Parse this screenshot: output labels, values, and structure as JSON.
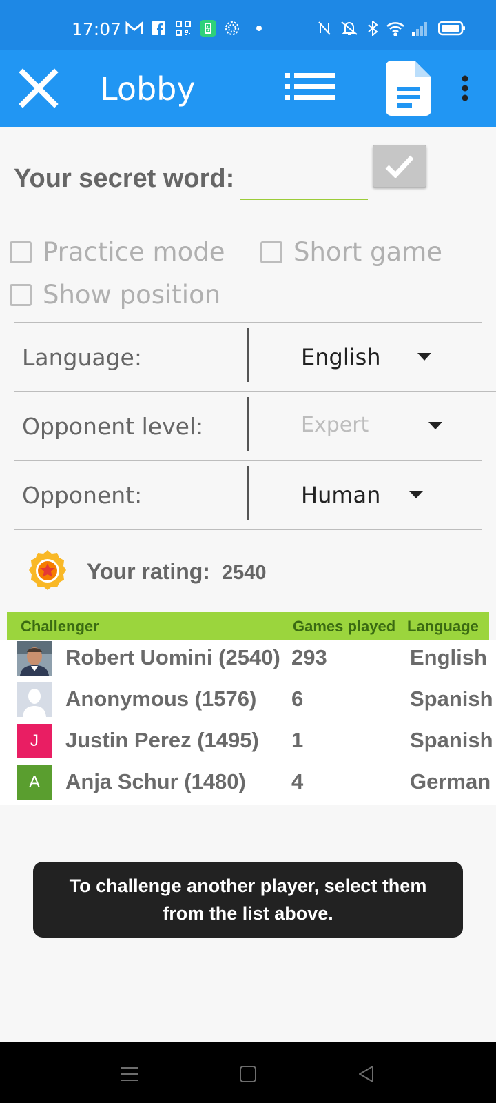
{
  "status_bar": {
    "time": "17:07",
    "left_icons": [
      "gmail-icon",
      "facebook-icon",
      "qr-icon",
      "battery-saver-icon",
      "gear-flower-icon",
      "dot-icon"
    ],
    "right_icons": [
      "nfc-icon",
      "mute-icon",
      "bluetooth-icon",
      "wifi-icon",
      "signal-icon",
      "battery-icon"
    ]
  },
  "appbar": {
    "title": "Lobby",
    "close_icon": "close-icon",
    "list_icon": "list-icon",
    "document_icon": "document-icon",
    "menu_icon": "overflow-menu-icon",
    "color": "#2196f3"
  },
  "secret_word": {
    "label": "Your secret word:",
    "value": "",
    "placeholder": ""
  },
  "options": {
    "practice_mode": {
      "label": "Practice mode",
      "checked": false
    },
    "short_game": {
      "label": "Short game",
      "checked": false
    },
    "show_position": {
      "label": "Show position",
      "checked": false
    }
  },
  "settings": {
    "language": {
      "label": "Language:",
      "value": "English"
    },
    "opponent_level": {
      "label": "Opponent level:",
      "value": "Expert",
      "disabled": true
    },
    "opponent": {
      "label": "Opponent:",
      "value": "Human"
    }
  },
  "rating": {
    "label": "Your rating:",
    "value": "2540",
    "icon": "award-badge-icon"
  },
  "table": {
    "headers": {
      "challenger": "Challenger",
      "games": "Games played",
      "language": "Language"
    },
    "header_color": "#9bd53d",
    "rows": [
      {
        "name": "Robert Uomini (2540)",
        "games": "293",
        "language": "English",
        "avatar": "photo",
        "initial": ""
      },
      {
        "name": "Anonymous (1576)",
        "games": "6",
        "language": "Spanish",
        "avatar": "silhouette",
        "initial": ""
      },
      {
        "name": "Justin Perez (1495)",
        "games": "1",
        "language": "Spanish",
        "avatar": "letter",
        "initial": "J",
        "color": "#e91e63"
      },
      {
        "name": "Anja Schur (1480)",
        "games": "4",
        "language": "German",
        "avatar": "letter",
        "initial": "A",
        "color": "#5a9e2f"
      }
    ]
  },
  "toast": {
    "line1": "To challenge another player, select them",
    "line2": "from the list above."
  },
  "nav_bar": {
    "icons": [
      "recents-icon",
      "home-icon",
      "back-icon"
    ]
  }
}
